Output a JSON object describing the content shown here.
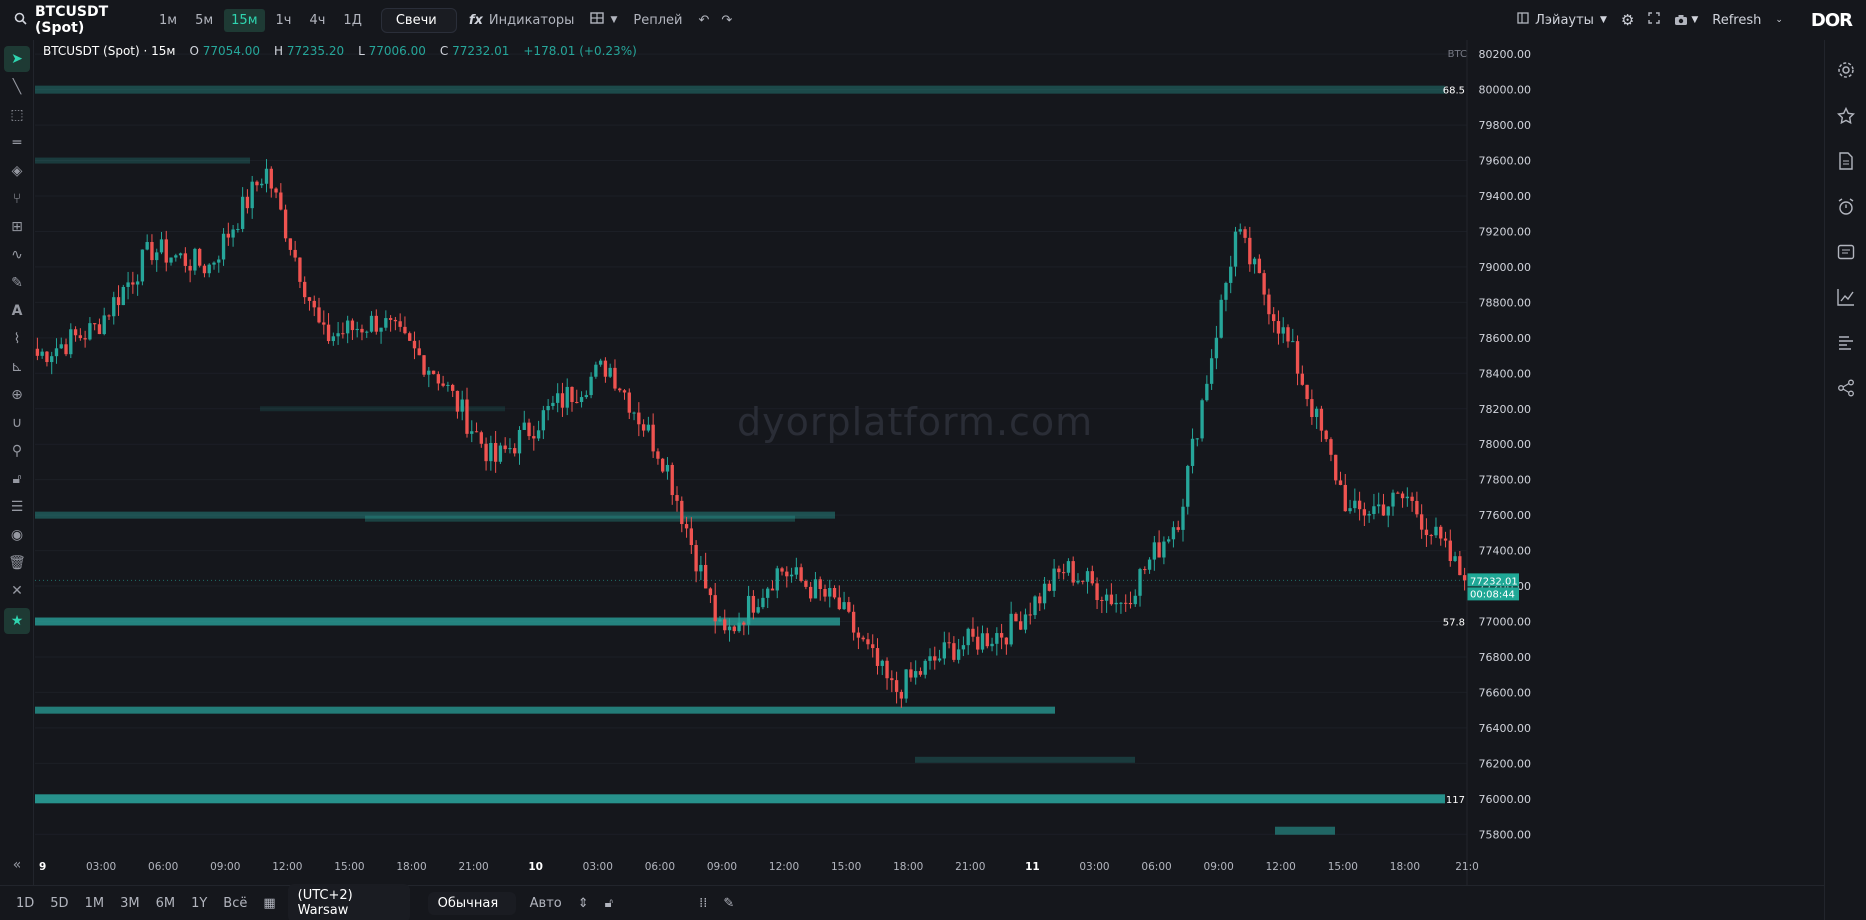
{
  "toolbar": {
    "symbol": "BTCUSDT (Spot)",
    "timeframes": [
      "1м",
      "5м",
      "15м",
      "1ч",
      "4ч",
      "1Д"
    ],
    "active_timeframe": "15м",
    "chart_type": "Свечи",
    "indicators_label": "Индикаторы",
    "replay_label": "Реплей",
    "layouts_label": "Лэйауты",
    "refresh_label": "Refresh",
    "logo": "DOR"
  },
  "legend": {
    "title": "BTCUSDT (Spot) · 15м",
    "o_label": "O",
    "o": "77054.00",
    "h_label": "H",
    "h": "77235.20",
    "l_label": "L",
    "l": "77006.00",
    "c_label": "C",
    "c": "77232.01",
    "change": "+178.01 (+0.23%)"
  },
  "watermark": "dyorplatform.com",
  "price_axis": {
    "currency": "BTC",
    "labels": [
      "80200.00",
      "80000.00",
      "79800.00",
      "79600.00",
      "79400.00",
      "79200.00",
      "79000.00",
      "78800.00",
      "78600.00",
      "78400.00",
      "78200.00",
      "78000.00",
      "77800.00",
      "77600.00",
      "77400.00",
      "77200.00",
      "77000.00",
      "76800.00",
      "76600.00",
      "76400.00",
      "76200.00",
      "76000.00",
      "75800.00"
    ],
    "last_price": "77232.01",
    "countdown": "00:08:44",
    "volume_labels": [
      "68.5",
      "57.8",
      "117"
    ]
  },
  "time_axis": {
    "labels": [
      "9",
      "03:00",
      "06:00",
      "09:00",
      "12:00",
      "15:00",
      "18:00",
      "21:00",
      "10",
      "03:00",
      "06:00",
      "09:00",
      "12:00",
      "15:00",
      "18:00",
      "21:00",
      "11",
      "03:00",
      "06:00",
      "09:00",
      "12:00",
      "15:00",
      "18:00",
      "21:0"
    ]
  },
  "bottombar": {
    "ranges": [
      "1D",
      "5D",
      "1M",
      "3M",
      "6M",
      "1Y",
      "Всё"
    ],
    "timezone": "(UTC+2) Warsaw",
    "scale_mode": "Обычная",
    "auto_label": "Авто"
  },
  "colors": {
    "up": "#26a69a",
    "down": "#ef5350",
    "accent": "#2fd5b0",
    "background": "#15171c"
  },
  "chart_data": {
    "type": "candlestick",
    "title": "BTCUSDT (Spot) · 15м",
    "xlabel": "",
    "ylabel": "",
    "ylim": [
      75700,
      80280
    ],
    "x": [
      "9 00:00",
      "9 06:00",
      "9 09:30",
      "9 12:00",
      "9 15:00",
      "9 18:00",
      "9 21:00",
      "10 03:00",
      "10 06:00",
      "10 09:00",
      "10 12:00",
      "10 13:45",
      "10 15:00",
      "10 18:00",
      "10 21:00",
      "11 00:30",
      "11 03:00",
      "11 06:00",
      "11 09:00",
      "11 12:00",
      "11 14:30",
      "11 15:30",
      "11 17:00",
      "11 18:30",
      "11 20:00",
      "11 21:00"
    ],
    "close": [
      78500,
      78650,
      79100,
      79000,
      79550,
      78600,
      78700,
      78400,
      77900,
      78200,
      78450,
      77900,
      76900,
      77300,
      77100,
      76600,
      76850,
      76950,
      77300,
      77100,
      77600,
      79200,
      78500,
      77600,
      77700,
      77232
    ],
    "volume_profile_levels": [
      80000,
      79600,
      78200,
      77600,
      77000,
      76500,
      76000
    ],
    "volume_profile_labels": {
      "80000": "68.5",
      "77000": "57.8",
      "76000": "117"
    }
  }
}
